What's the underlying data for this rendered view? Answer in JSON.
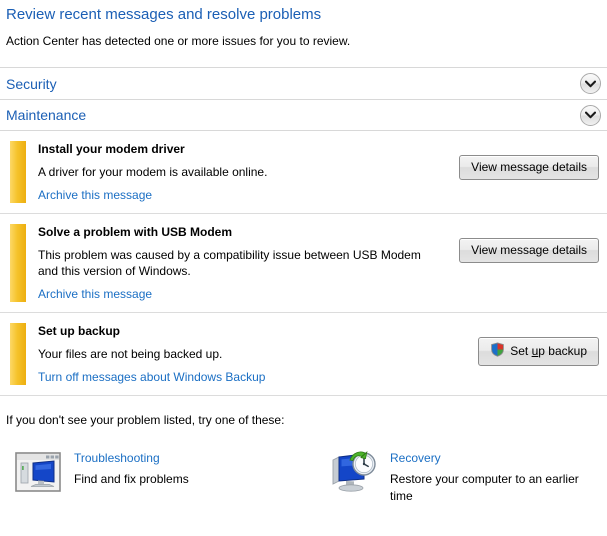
{
  "header": {
    "title": "Review recent messages and resolve problems",
    "subtitle": "Action Center has detected one or more issues for you to review."
  },
  "sections": [
    {
      "label": "Security",
      "expand_icon": "chevron-down-icon"
    },
    {
      "label": "Maintenance",
      "expand_icon": "chevron-down-icon"
    }
  ],
  "messages": [
    {
      "title": "Install your modem driver",
      "description": "A driver for your modem is available online.",
      "link": "Archive this message",
      "button": {
        "label": "View message details",
        "has_shield": false
      },
      "severity_color": "#F5C32B"
    },
    {
      "title": "Solve a problem with USB Modem",
      "description": "This problem was caused by a compatibility issue between USB Modem and this version of Windows.",
      "link": "Archive this message",
      "button": {
        "label": "View message details",
        "has_shield": false
      },
      "severity_color": "#F5C32B"
    },
    {
      "title": "Set up backup",
      "description": "Your files are not being backed up.",
      "link": "Turn off messages about Windows Backup",
      "button": {
        "label_before": "Set ",
        "accel": "u",
        "label_after": "p backup",
        "has_shield": true,
        "shield_icon": "uac-shield-icon"
      },
      "severity_color": "#F5C32B"
    }
  ],
  "footer": {
    "prompt": "If you don't see your problem listed, try one of these:",
    "items": [
      {
        "icon": "troubleshooting-icon",
        "link": "Troubleshooting",
        "description": "Find and fix problems"
      },
      {
        "icon": "recovery-icon",
        "link": "Recovery",
        "description": "Restore your computer to an earlier time"
      }
    ]
  },
  "colors": {
    "link_blue": "#1B6FC4",
    "title_blue": "#1B5FB5",
    "warning_yellow": "#F5C32B",
    "divider": "#D8D8D8"
  }
}
